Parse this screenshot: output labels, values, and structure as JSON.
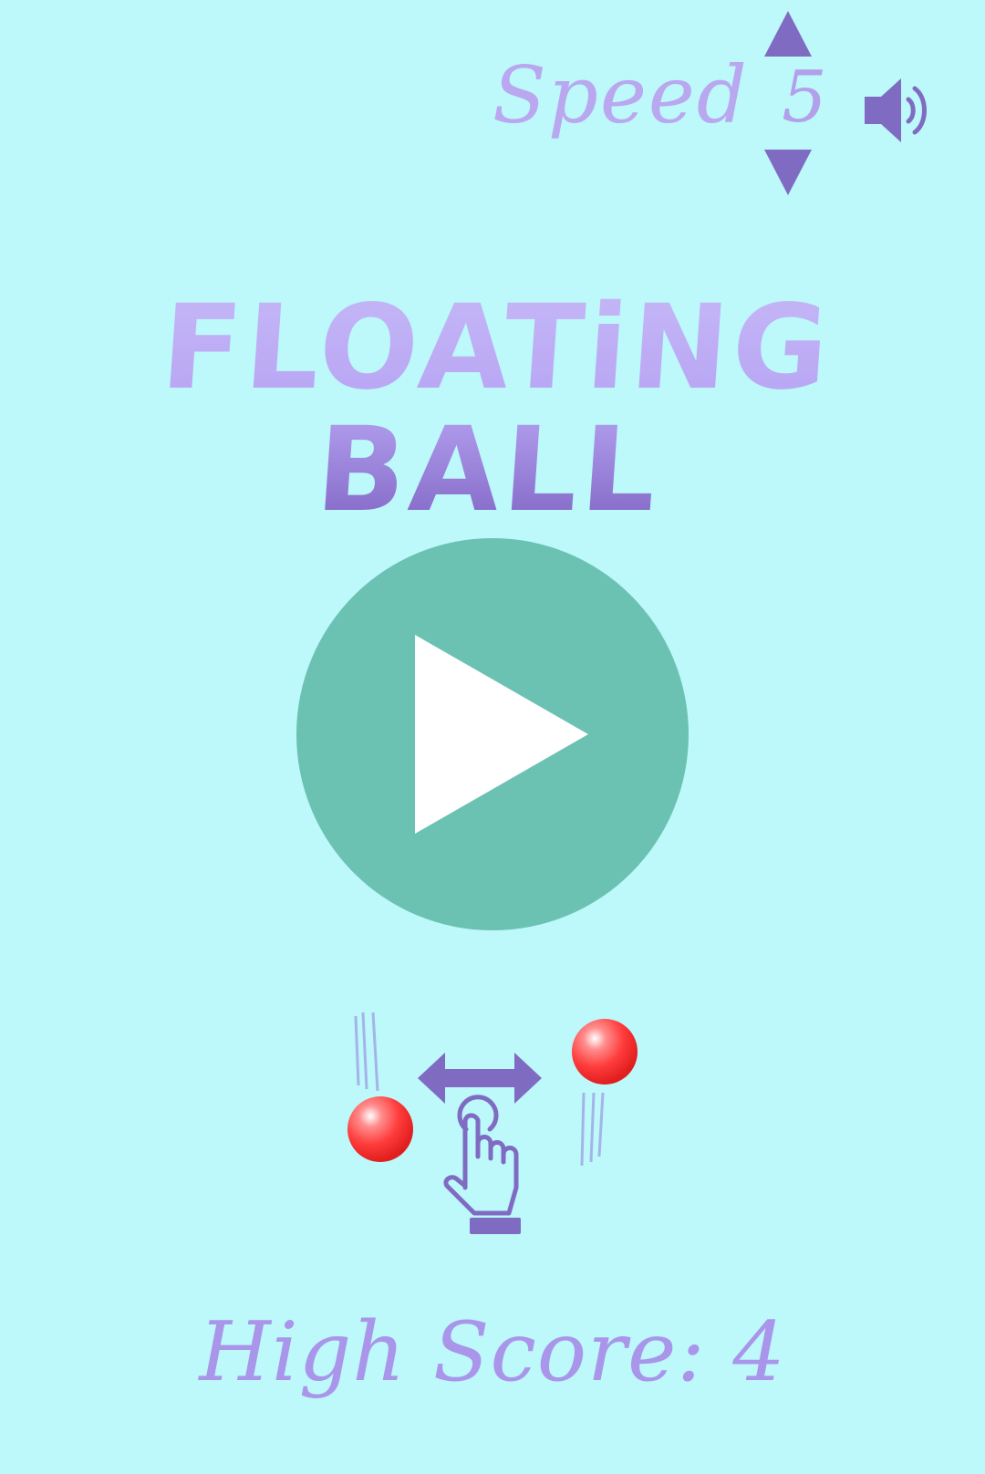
{
  "header": {
    "speed_label": "Speed",
    "speed_value": "5",
    "speed_up_icon": "triangle-up-icon",
    "speed_down_icon": "triangle-down-icon",
    "sound_icon": "speaker-icon"
  },
  "title": "FLOATiNG BALL",
  "play": {
    "icon": "play-icon"
  },
  "instructions": {
    "icons": [
      "falling-ball-icon",
      "left-right-arrow-icon",
      "tap-hand-icon",
      "rising-ball-icon"
    ]
  },
  "high_score": {
    "text": "High Score: 4"
  },
  "colors": {
    "background": "#bdf8fb",
    "accent_purple": "#7f6cc2",
    "play_green": "#6bc2b3",
    "ball_red": "#ff4a4a"
  }
}
